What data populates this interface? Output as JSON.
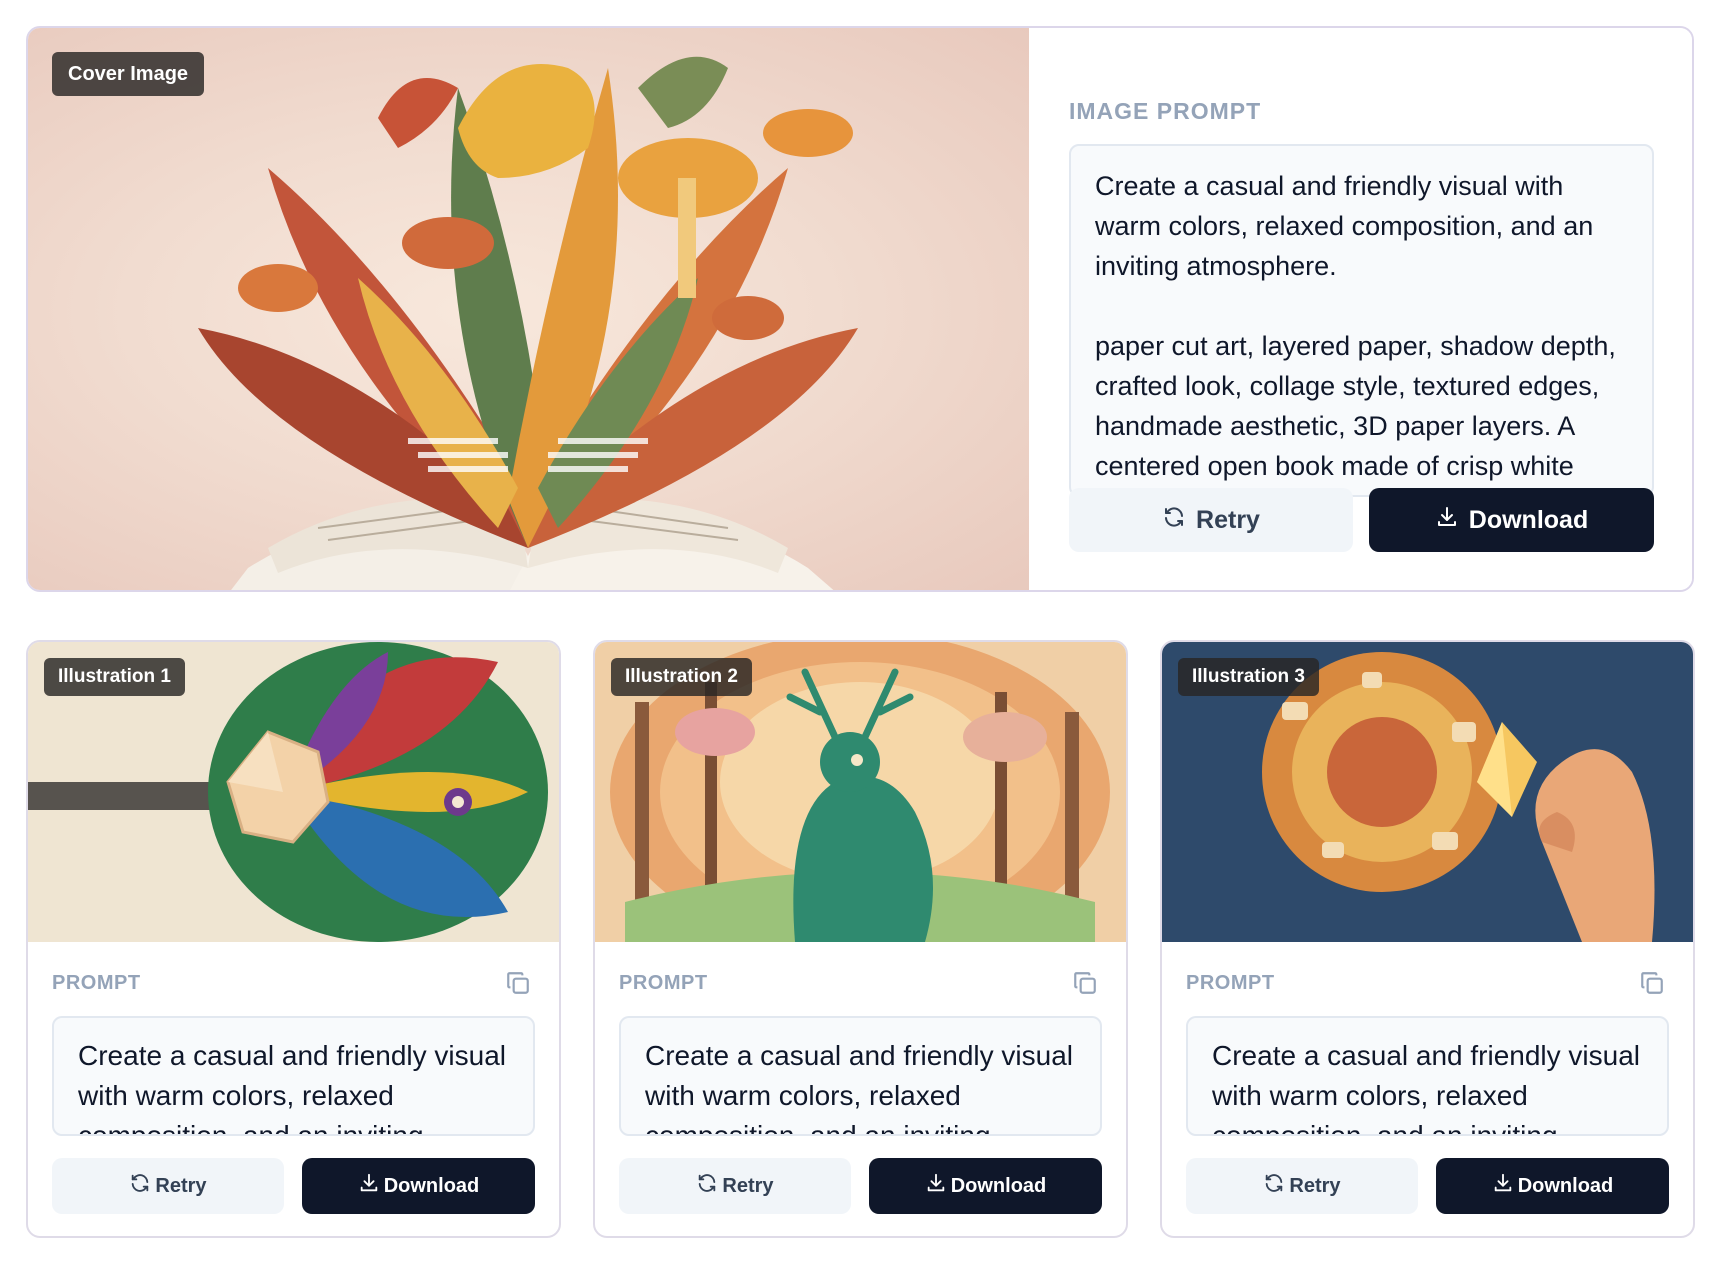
{
  "cover": {
    "badge": "Cover Image",
    "heading": "IMAGE PROMPT",
    "prompt": "Create a casual and friendly visual with warm colors, relaxed composition, and an inviting atmosphere.\n\npaper cut art, layered paper, shadow depth, crafted look, collage style, textured edges, handmade aesthetic, 3D paper layers. A centered open book made of crisp white paper layers. From the",
    "retry_label": "Retry",
    "download_label": "Download"
  },
  "illustrations": [
    {
      "badge": "Illustration 1",
      "heading": "PROMPT",
      "prompt": "Create a casual and friendly visual with warm colors, relaxed composition, and an inviting",
      "retry_label": "Retry",
      "download_label": "Download"
    },
    {
      "badge": "Illustration 2",
      "heading": "PROMPT",
      "prompt": "Create a casual and friendly visual with warm colors, relaxed composition, and an inviting",
      "retry_label": "Retry",
      "download_label": "Download"
    },
    {
      "badge": "Illustration 3",
      "heading": "PROMPT",
      "prompt": "Create a casual and friendly visual with warm colors, relaxed composition, and an inviting",
      "retry_label": "Retry",
      "download_label": "Download"
    }
  ],
  "icons": {
    "retry": "refresh-icon",
    "download": "download-icon",
    "copy": "copy-icon"
  },
  "colors": {
    "primary_button": "#0f172a",
    "secondary_button": "#f1f5f9",
    "muted_heading": "#94a3b8",
    "card_border": "#dcd6ea"
  }
}
